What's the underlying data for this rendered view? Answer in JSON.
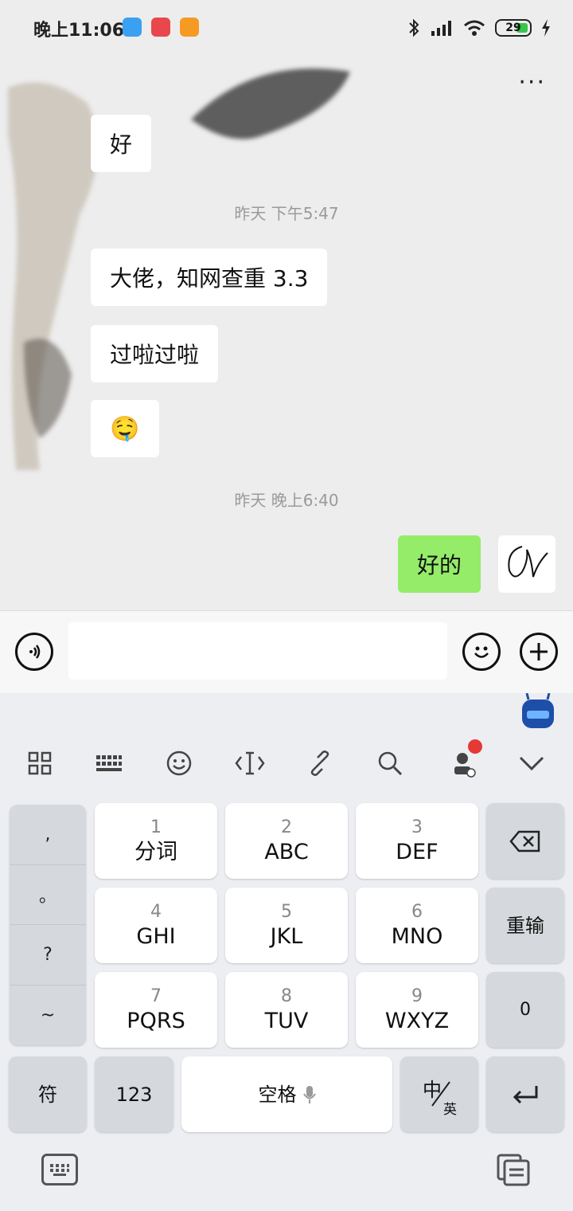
{
  "status_bar": {
    "time": "晚上11:06",
    "battery": "29"
  },
  "chat": {
    "messages": [
      {
        "text": "好"
      },
      {
        "timestamp": "昨天 下午5:47"
      },
      {
        "text": "大佬，知网查重 3.3"
      },
      {
        "text": "过啦过啦"
      },
      {
        "emoji": "🤤"
      },
      {
        "timestamp": "昨天 晚上6:40"
      },
      {
        "text": "好的"
      }
    ]
  },
  "keyboard": {
    "side": [
      ",",
      "。",
      "?",
      "~"
    ],
    "keys": [
      {
        "num": "1",
        "letters": "分词"
      },
      {
        "num": "2",
        "letters": "ABC"
      },
      {
        "num": "3",
        "letters": "DEF"
      },
      {
        "num": "4",
        "letters": "GHI"
      },
      {
        "num": "5",
        "letters": "JKL"
      },
      {
        "num": "6",
        "letters": "MNO"
      },
      {
        "num": "7",
        "letters": "PQRS"
      },
      {
        "num": "8",
        "letters": "TUV"
      },
      {
        "num": "9",
        "letters": "WXYZ"
      }
    ],
    "reinput": "重输",
    "zero": "0",
    "symbol": "符",
    "num123": "123",
    "space": "空格",
    "lang_zh": "中",
    "lang_en": "英"
  },
  "colors": {
    "sent_bubble": "#95ec69",
    "received_bubble": "#ffffff",
    "notification_dot": "#e53935"
  }
}
